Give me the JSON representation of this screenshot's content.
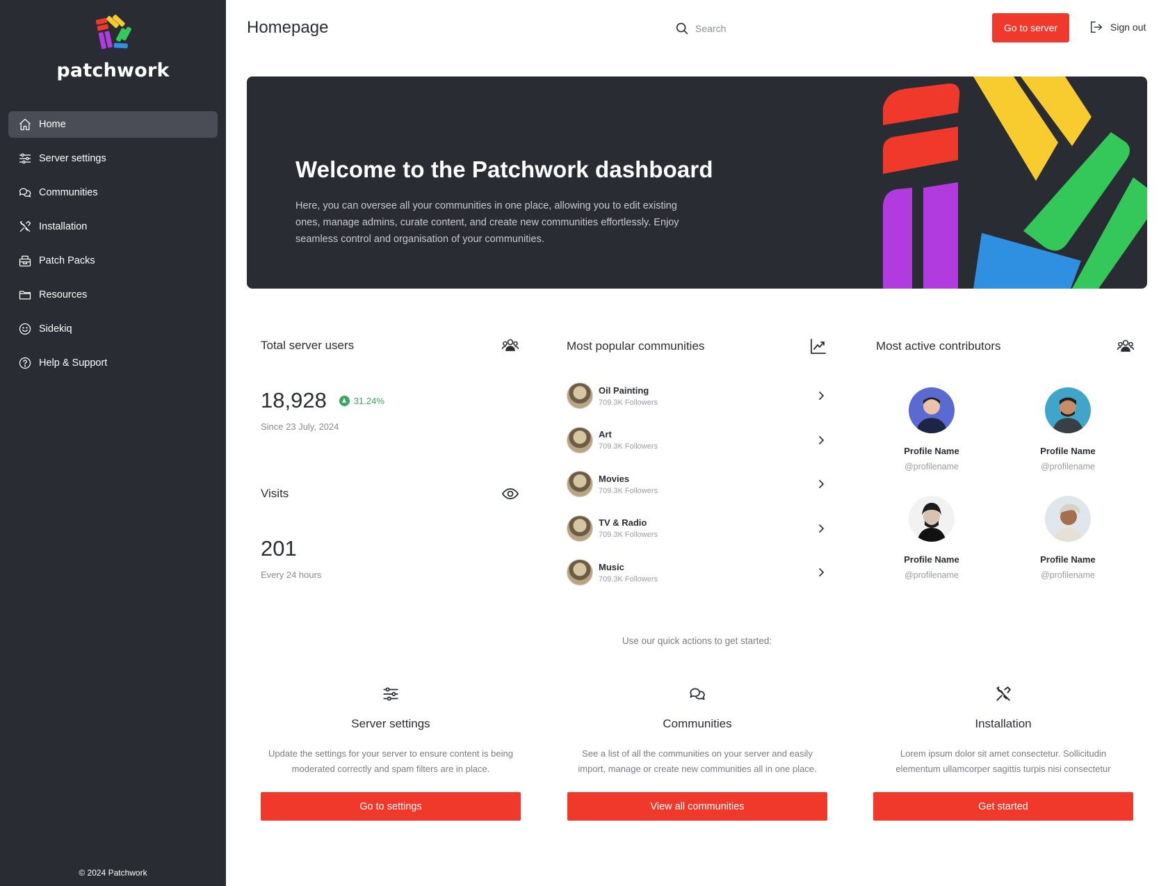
{
  "app": {
    "brand": "patchwork",
    "footer": "© 2024 Patchwork"
  },
  "sidebar": {
    "items": [
      {
        "label": "Home",
        "icon": "home-icon",
        "active": true
      },
      {
        "label": "Server settings",
        "icon": "sliders-icon"
      },
      {
        "label": "Communities",
        "icon": "chat-bubbles-icon"
      },
      {
        "label": "Installation",
        "icon": "tools-icon"
      },
      {
        "label": "Patch Packs",
        "icon": "package-icon"
      },
      {
        "label": "Resources",
        "icon": "folder-icon"
      },
      {
        "label": "Sidekiq",
        "icon": "smiley-icon"
      },
      {
        "label": "Help & Support",
        "icon": "help-circle-icon"
      }
    ]
  },
  "header": {
    "title": "Homepage",
    "search_placeholder": "Search",
    "go_to_server": "Go to server",
    "sign_out": "Sign out"
  },
  "hero": {
    "title": "Welcome to the Patchwork dashboard",
    "text": "Here, you can oversee all your communities in one place, allowing you to edit existing ones, manage admins, curate content, and create new communities effortlessly. Enjoy seamless control and organisation of your communities."
  },
  "stats": {
    "users": {
      "title": "Total server users",
      "value": "18,928",
      "trend": "31.24%",
      "since": "Since 23 July, 2024"
    },
    "visits": {
      "title": "Visits",
      "value": "201",
      "period": "Every 24 hours"
    }
  },
  "popular": {
    "title": "Most popular communities",
    "items": [
      {
        "name": "Oil Painting",
        "followers": "709.3K Followers"
      },
      {
        "name": "Art",
        "followers": "709.3K Followers"
      },
      {
        "name": "Movies",
        "followers": "709.3K Followers"
      },
      {
        "name": "TV & Radio",
        "followers": "709.3K Followers"
      },
      {
        "name": "Music",
        "followers": "709.3K Followers"
      }
    ]
  },
  "contributors": {
    "title": "Most active contributors",
    "items": [
      {
        "name": "Profile Name",
        "handle": "@profilename"
      },
      {
        "name": "Profile Name",
        "handle": "@profilename"
      },
      {
        "name": "Profile Name",
        "handle": "@profilename"
      },
      {
        "name": "Profile Name",
        "handle": "@profilename"
      }
    ]
  },
  "quick_actions": {
    "caption": "Use our quick actions to get started:",
    "items": [
      {
        "title": "Server settings",
        "desc": "Update the settings for your server to ensure content is being moderated correctly and spam filters are in place.",
        "button": "Go to settings",
        "icon": "sliders-icon"
      },
      {
        "title": "Communities",
        "desc": "See a list of all the communities on your server and easily import, manage or create new communities all in one place.",
        "button": "View all communities",
        "icon": "chat-bubbles-icon"
      },
      {
        "title": "Installation",
        "desc": "Lorem ipsum dolor sit amet consectetur. Sollicitudin elementum ullamcorper sagittis turpis nisi consectetur",
        "button": "Get started",
        "icon": "tools-icon"
      }
    ]
  },
  "colors": {
    "sidebar_bg": "#2a2c33",
    "accent_red": "#f0382b",
    "trend_green": "#3aa55c",
    "brand_yellow": "#f8cb2e",
    "brand_green": "#34c759",
    "brand_blue": "#2f8fe0",
    "brand_purple": "#b23be0"
  }
}
